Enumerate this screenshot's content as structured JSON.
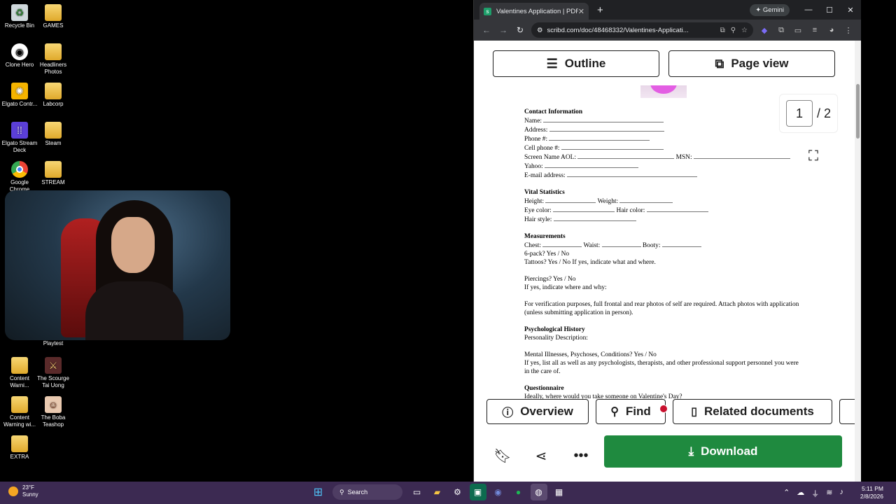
{
  "desktop": {
    "icons_left": [
      {
        "label": "Recycle Bin",
        "icon": "recycle-bin-icon"
      },
      {
        "label": "Clone Hero",
        "icon": "clone-hero-icon"
      },
      {
        "label": "Elgato Contr...",
        "icon": "elgato-control-icon"
      },
      {
        "label": "Elgato Stream Deck",
        "icon": "stream-deck-icon"
      },
      {
        "label": "Google Chrome",
        "icon": "chrome-icon"
      },
      {
        "label": "Content Warni...",
        "icon": "folder-icon"
      },
      {
        "label": "Content Warning wi...",
        "icon": "folder-icon"
      },
      {
        "label": "EXTRA",
        "icon": "folder-icon"
      }
    ],
    "icons_right": [
      {
        "label": "GAMES",
        "icon": "folder-icon"
      },
      {
        "label": "Headliners Photos",
        "icon": "folder-icon"
      },
      {
        "label": "Labcorp",
        "icon": "folder-icon"
      },
      {
        "label": "Steam",
        "icon": "folder-icon"
      },
      {
        "label": "STREAM",
        "icon": "folder-icon"
      },
      {
        "label": "Playtest",
        "icon": "playtest-icon"
      },
      {
        "label": "The Scourge Tai Uong",
        "icon": "game-shortcut-icon"
      },
      {
        "label": "The Boba Teashop",
        "icon": "game-shortcut-icon"
      }
    ]
  },
  "browser": {
    "tab_title": "Valentines Application | PDF",
    "gemini_label": "Gemini",
    "url": "scribd.com/doc/48468332/Valentines-Applicati..."
  },
  "viewer": {
    "outline_label": "Outline",
    "pageview_label": "Page view",
    "current_page": "1",
    "total_pages": "/ 2",
    "overview_label": "Overview",
    "find_label": "Find",
    "related_label": "Related documents",
    "download_label": "Download"
  },
  "document": {
    "contact_heading": "Contact Information",
    "name": "Name:",
    "address": "Address:",
    "phone": "Phone #:",
    "cell": "Cell phone #:",
    "screen_aol": "Screen Name AOL:",
    "msn": "MSN:",
    "yahoo": "Yahoo:",
    "email": "E-mail address:",
    "vital_heading": "Vital Statistics",
    "height": "Height:",
    "weight": "Weight:",
    "eye": "Eye color:",
    "hair_color": "Hair color:",
    "hair_style": "Hair style:",
    "measure_heading": "Measurements",
    "chest": "Chest:",
    "waist": "Waist:",
    "booty": "Booty:",
    "sixpack": "6-pack? Yes / No",
    "tattoos": "Tattoos? Yes / No If yes, indicate what and where.",
    "piercings": "Piercings? Yes / No",
    "piercings_where": "If yes, indicate where and why:",
    "verification": "For verification purposes, full frontal and rear photos of self are required. Attach photos with application (unless submitting application in person).",
    "psych_heading": "Psychological History",
    "personality": "Personality Description:",
    "mental": "Mental Illnesses, Psychoses, Conditions? Yes / No",
    "mental_list": "If yes, list all as well as any psychologists, therapists, and other professional support personnel you were in the care of.",
    "quest_heading": "Questionnaire",
    "quest_1": "Ideally, where would you take someone on Valentine's Day?"
  },
  "taskbar": {
    "temp": "23°F",
    "condition": "Sunny",
    "search_label": "Search",
    "time": "5:11 PM",
    "date": "2/8/2026"
  }
}
